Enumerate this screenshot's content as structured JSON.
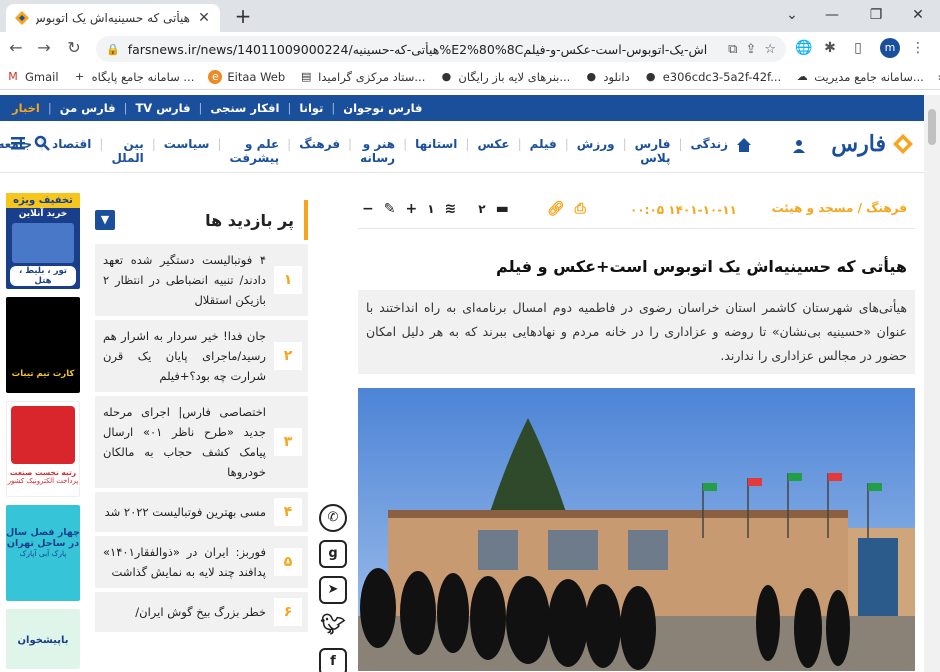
{
  "browser": {
    "tab_title": "هیأتی که حسینیه‌اش یک اتوبوس",
    "url": "farsnews.ir/news/14011009000224/هیأتی-که-حسینیه%E2%80%8Cاش-یک-اتوبوس-است-عکس-و-فیلم",
    "profile_initial": "m",
    "bookmarks": [
      {
        "label": "Gmail",
        "icon": "gmail-icon"
      },
      {
        "label": "سامانه جامع پایگاه ...",
        "icon": "plus-icon"
      },
      {
        "label": "Eitaa Web",
        "icon": "eitaa-icon"
      },
      {
        "label": "ستاد مرکزی گرامیدا...",
        "icon": "doc-icon"
      },
      {
        "label": "بنرهای لایه باز رایگان...",
        "icon": "github-icon"
      },
      {
        "label": "دانلود",
        "icon": "github-icon"
      },
      {
        "label": "e306cdc3-5a2f-42f...",
        "icon": "github-icon"
      },
      {
        "label": "سامانه جامع مدیریت...",
        "icon": "cloud-icon"
      }
    ]
  },
  "site": {
    "logo_text": "فارس",
    "top_strip": [
      "اخبار",
      "فارس من",
      "فارس TV",
      "افکار سنجی",
      "توانا",
      "فارس نوجوان"
    ],
    "nav": [
      "جامعه",
      "اقتصاد",
      "بین الملل",
      "سیاست",
      "علم و پیشرفت",
      "فرهنگ",
      "هنر و رسانه",
      "استانها",
      "عکس",
      "فیلم",
      "ورزش",
      "فارس پلاس",
      "زندگی"
    ]
  },
  "ads": [
    {
      "line1": "تخفیف ویژه",
      "line2": "خرید آنلاین",
      "line3": "تور ، بلیط ، هتل"
    },
    {
      "line1": "کارت تیم تیبات",
      "line2": ""
    },
    {
      "line1": "رتبه نخست صنعت",
      "line2": "پرداخت الکترونیک کشور"
    },
    {
      "line1": "چهار فصل سال",
      "line2": "در ساحل تهران",
      "line3": "پارک آبی آپارک"
    },
    {
      "line1": "باپیشخوان",
      "line2": ""
    }
  ],
  "popular": {
    "title": "پر بازدید ها",
    "items": [
      {
        "num": "۱",
        "text": "۴ فوتبالیست دستگیر شده تعهد دادند/ تنبیه انضباطی در انتظار ۲ بازیکن استقلال"
      },
      {
        "num": "۲",
        "text": "جان فدا! خیر سردار به اشرار هم رسید/ماجرای پایان یک قرن شرارت چه بود؟+فیلم"
      },
      {
        "num": "۳",
        "text": "اختصاصی فارس| اجرای مرحله جدید «طرح ناظر ۰۱» ارسال پیامک کشف حجاب به مالکان خودروها"
      },
      {
        "num": "۴",
        "text": "مسی بهترین فوتبالیست ۲۰۲۲ شد"
      },
      {
        "num": "۵",
        "text": "فوربز: ایران در «ذوالفقار۱۴۰۱» پدافند چند لایه به نمایش گذاشت"
      },
      {
        "num": "۶",
        "text": "خطر بزرگ بیخ گوش ایران/"
      }
    ]
  },
  "article": {
    "category": "فرهنگ / مسجد و هیئت",
    "datetime": "۱۴۰۱-۱۰-۱۱ ۰۰:۰۵",
    "comments": "۲",
    "likes": "۱",
    "headline": "هیأتی که حسینیه‌اش یک اتوبوس است+عکس و فیلم",
    "lead": "هیأتی‌های شهرستان کاشمر استان خراسان رضوی در فاطمیه دوم امسال برنامه‌ای به راه انداختند با عنوان «حسینیه بی‌نشان» تا روضه و عزاداری را در خانه مردم و نهادهایی ببرند که به هر دلیل امکان حضور در مجالس عزاداری را ندارند."
  },
  "colors": {
    "brand_blue": "#1a4f9c",
    "accent_orange": "#f7a51c"
  }
}
